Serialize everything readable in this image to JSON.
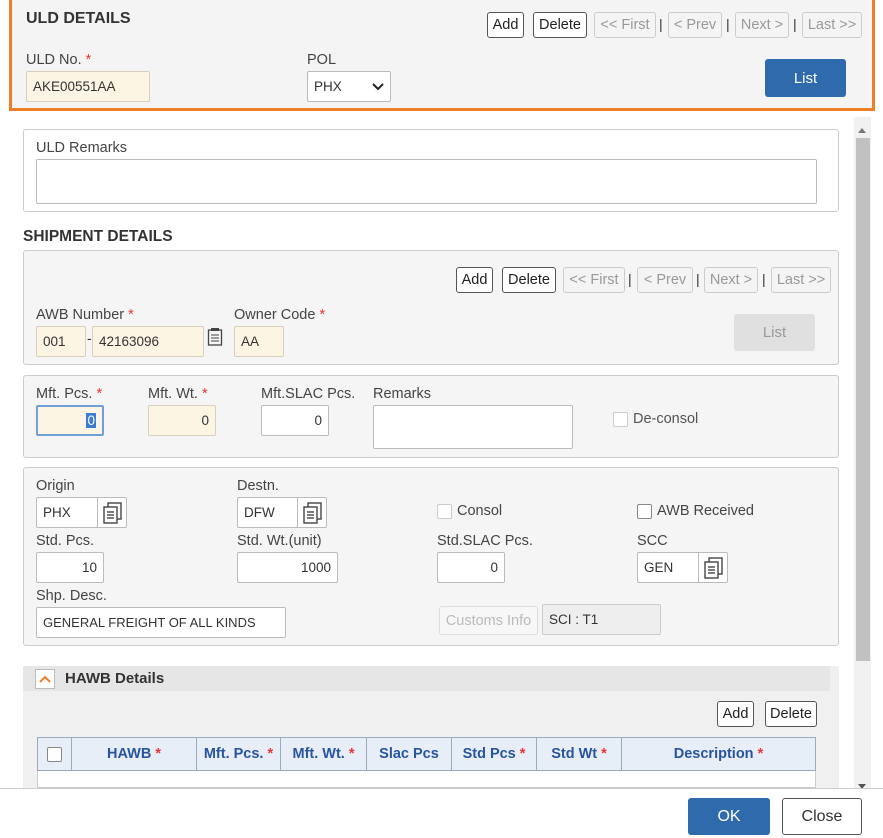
{
  "header": {
    "title": "ULD DETAILS",
    "nav": {
      "add": "Add",
      "delete": "Delete",
      "first": "<< First",
      "prev": "< Prev",
      "next": "Next >",
      "last": "Last >>"
    },
    "uld_no_label": "ULD No.",
    "uld_no_value": "AKE00551AA",
    "pol_label": "POL",
    "pol_value": "PHX",
    "list_button": "List"
  },
  "uld_remarks": {
    "label": "ULD Remarks",
    "value": ""
  },
  "shipment": {
    "title": "SHIPMENT DETAILS",
    "nav": {
      "add": "Add",
      "delete": "Delete",
      "first": "<< First",
      "prev": "< Prev",
      "next": "Next >",
      "last": "Last >>"
    },
    "awb_label": "AWB Number",
    "awb_prefix": "001",
    "awb_number": "42163096",
    "owner_code_label": "Owner Code",
    "owner_code": "AA",
    "list_button": "List"
  },
  "manifest": {
    "mft_pcs_label": "Mft. Pcs.",
    "mft_pcs": "0",
    "mft_wt_label": "Mft. Wt.",
    "mft_wt": "0",
    "mft_slac_label": "Mft.SLAC Pcs.",
    "mft_slac": "0",
    "remarks_label": "Remarks",
    "deconsol_label": "De-consol"
  },
  "details": {
    "origin_label": "Origin",
    "origin": "PHX",
    "destn_label": "Destn.",
    "destn": "DFW",
    "consol_label": "Consol",
    "awb_received_label": "AWB Received",
    "std_pcs_label": "Std. Pcs.",
    "std_pcs": "10",
    "std_wt_label": "Std. Wt.(unit)",
    "std_wt": "1000",
    "std_slac_label": "Std.SLAC Pcs.",
    "std_slac": "0",
    "scc_label": "SCC",
    "scc": "GEN",
    "shp_desc_label": "Shp. Desc.",
    "shp_desc": "GENERAL FREIGHT OF ALL KINDS",
    "customs_info": "Customs Info",
    "sci": "SCI : T1"
  },
  "hawb": {
    "title": "HAWB Details",
    "add": "Add",
    "delete": "Delete",
    "columns": [
      "HAWB",
      "Mft. Pcs.",
      "Mft. Wt.",
      "Slac Pcs",
      "Std Pcs",
      "Std Wt",
      "Description"
    ]
  },
  "footer": {
    "ok": "OK",
    "close": "Close"
  },
  "colors": {
    "accent": "#f07e26",
    "primary": "#2e6aac",
    "mandatory_bg": "#fdf5e4",
    "required": "#e33333"
  }
}
